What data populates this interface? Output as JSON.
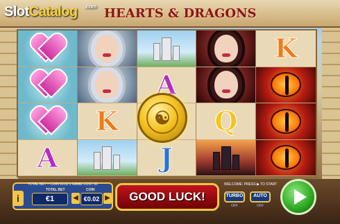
{
  "header": {
    "site_logo_main": "Slot",
    "site_logo_accent": "Catalog",
    "site_logo_suffix": ".com",
    "game_title": "HEARTS & DRAGONS"
  },
  "reels": [
    [
      "heart",
      "heart",
      "heart",
      "A"
    ],
    [
      "queen",
      "queen",
      "K",
      "castle"
    ],
    [
      "castle",
      "A",
      "wild",
      "J"
    ],
    [
      "villain",
      "villain",
      "Q",
      "darkcastle"
    ],
    [
      "K",
      "eye",
      "eye",
      "eye"
    ]
  ],
  "controls": {
    "info_label": "i",
    "total_bet_header": "TOTAL BET = COIN €0.02 x GAME COST 50",
    "total_bet_label": "TOTAL BET",
    "total_bet_value": "€1",
    "coin_label": "COIN",
    "coin_value": "€0.02",
    "message": "GOOD LUCK!",
    "welcome_text": "WELCOME: PRESS ▶ TO START",
    "turbo_label": "TURBO",
    "turbo_state": "OFF",
    "auto_label": "AUTO",
    "auto_state": "OFF"
  },
  "icons": {
    "spin": "play-icon",
    "wild": "dragon-coin-icon"
  },
  "colors": {
    "accent_gold": "#f2c64b",
    "message_red": "#c0141c",
    "spin_green": "#2ea622"
  }
}
